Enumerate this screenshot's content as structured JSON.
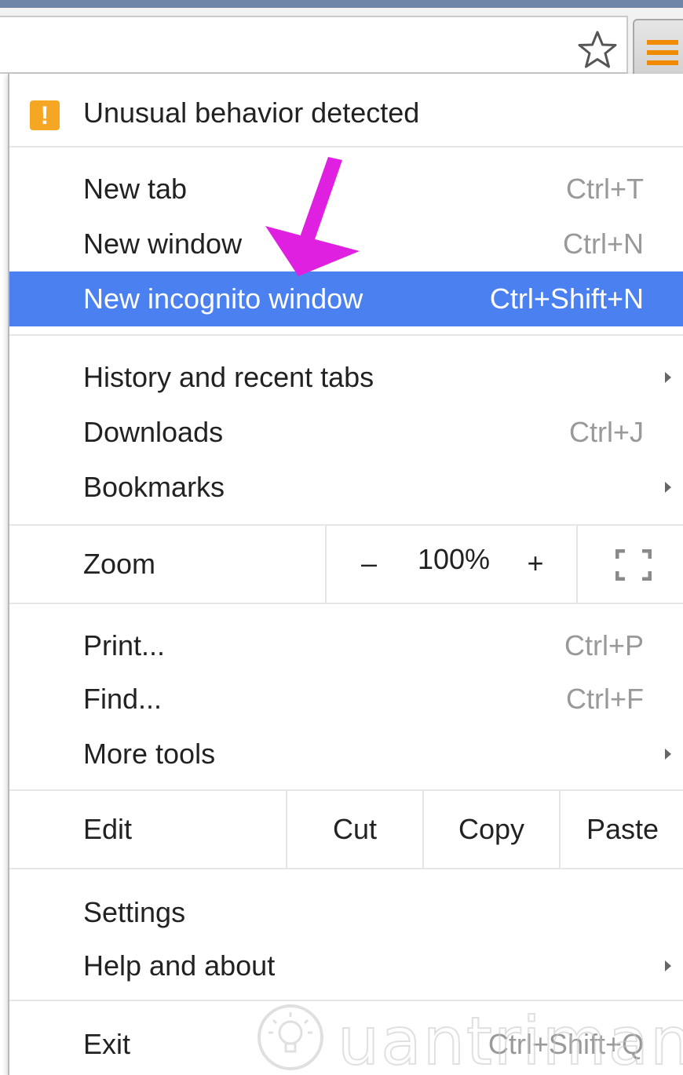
{
  "toolbar": {
    "star_icon": "star-outline-icon",
    "menu_icon": "hamburger-icon",
    "menu_icon_color": "#f08a00"
  },
  "menu": {
    "alert": {
      "label": "Unusual behavior detected",
      "icon": "warning-icon",
      "color": "#f5a623"
    },
    "new_tab": {
      "label": "New tab",
      "shortcut": "Ctrl+T"
    },
    "new_window": {
      "label": "New window",
      "shortcut": "Ctrl+N"
    },
    "new_incognito": {
      "label": "New incognito window",
      "shortcut": "Ctrl+Shift+N",
      "highlight_color": "#4a80f0"
    },
    "history": {
      "label": "History and recent tabs"
    },
    "downloads": {
      "label": "Downloads",
      "shortcut": "Ctrl+J"
    },
    "bookmarks": {
      "label": "Bookmarks"
    },
    "zoom": {
      "label": "Zoom",
      "minus": "–",
      "value": "100%",
      "plus": "+"
    },
    "print": {
      "label": "Print...",
      "shortcut": "Ctrl+P"
    },
    "find": {
      "label": "Find...",
      "shortcut": "Ctrl+F"
    },
    "more_tools": {
      "label": "More tools"
    },
    "edit": {
      "label": "Edit",
      "cut": "Cut",
      "copy": "Copy",
      "paste": "Paste"
    },
    "settings": {
      "label": "Settings"
    },
    "help": {
      "label": "Help and about"
    },
    "exit": {
      "label": "Exit",
      "shortcut": "Ctrl+Shift+Q"
    }
  },
  "annotation": {
    "arrow_color": "#e020e0"
  },
  "watermark": {
    "text": "uantrimang"
  }
}
